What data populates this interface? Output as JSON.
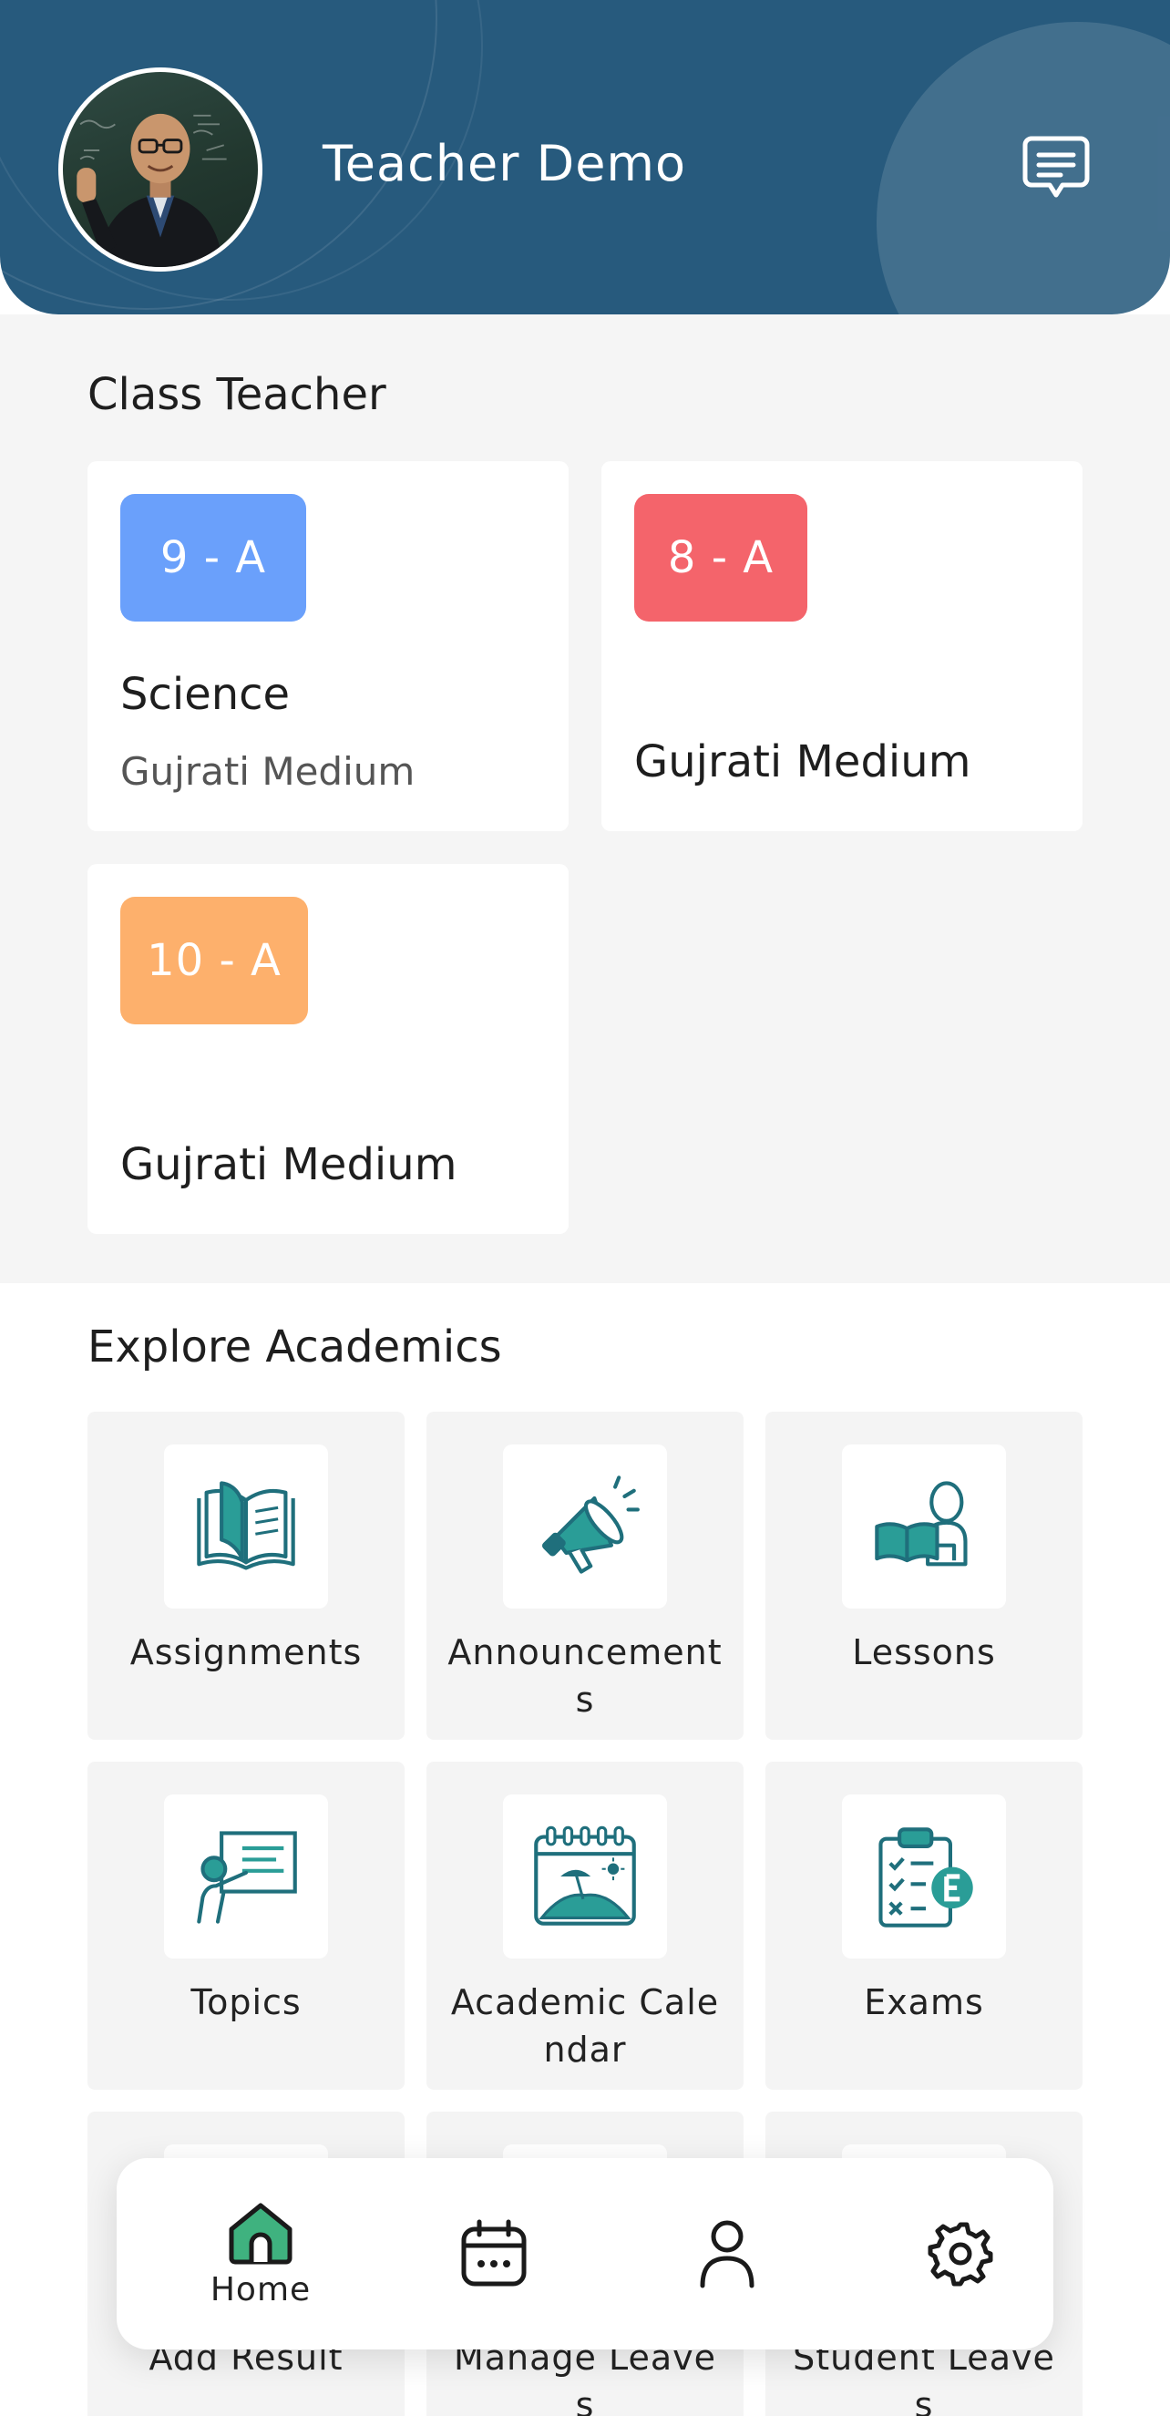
{
  "header": {
    "teacher_name": "Teacher Demo",
    "colors": {
      "background": "#275a7d"
    }
  },
  "class_teacher": {
    "title": "Class Teacher",
    "classes": [
      {
        "badge": "9 - A",
        "badge_color": "#6aa0fb",
        "subject": "Science",
        "medium": "Gujrati Medium"
      },
      {
        "badge": "8 - A",
        "badge_color": "#f4646b",
        "subject": "",
        "medium": "Gujrati Medium"
      },
      {
        "badge": "10 - A",
        "badge_color": "#fdb06c",
        "subject": "",
        "medium": "Gujrati Medium"
      }
    ]
  },
  "explore": {
    "title": "Explore Academics",
    "tiles": [
      {
        "label": "Assignments",
        "icon": "open-book-icon"
      },
      {
        "label": "Announcements",
        "icon": "megaphone-icon"
      },
      {
        "label": "Lessons",
        "icon": "reading-student-icon"
      },
      {
        "label": "Topics",
        "icon": "presentation-board-icon"
      },
      {
        "label": "Academic Calendar",
        "icon": "calendar-beach-icon"
      },
      {
        "label": "Exams",
        "icon": "exam-clipboard-icon"
      },
      {
        "label": "Add Result",
        "icon": "result-icon"
      },
      {
        "label": "Manage Leaves",
        "icon": "leave-icon"
      },
      {
        "label": "Student Leaves",
        "icon": "student-leave-icon"
      }
    ],
    "icon_color": "#1f6f7c",
    "icon_accent": "#2a9d97"
  },
  "bottom_nav": {
    "items": [
      {
        "label": "Home",
        "icon": "home-icon",
        "active": true
      },
      {
        "label": "",
        "icon": "calendar-icon",
        "active": false
      },
      {
        "label": "",
        "icon": "profile-icon",
        "active": false
      },
      {
        "label": "",
        "icon": "settings-icon",
        "active": false
      }
    ],
    "active_color": "#3fb27f"
  }
}
